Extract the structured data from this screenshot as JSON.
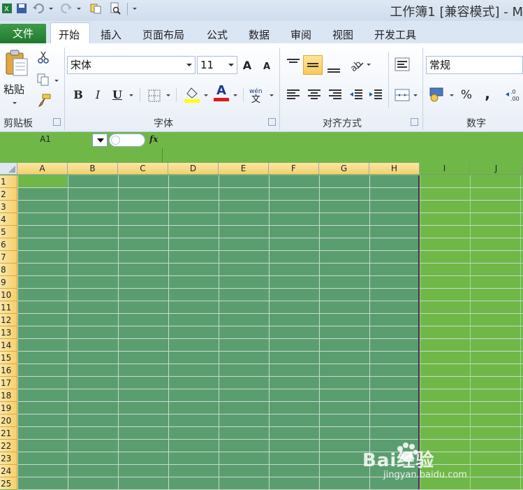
{
  "window": {
    "title": "工作簿1  [兼容模式]  -  M"
  },
  "tabs": {
    "file": "文件",
    "items": [
      "开始",
      "插入",
      "页面布局",
      "公式",
      "数据",
      "审阅",
      "视图",
      "开发工具"
    ]
  },
  "clipboard": {
    "paste_label": "粘贴",
    "group_label": "剪贴板"
  },
  "font": {
    "name": "宋体",
    "size": "11",
    "group_label": "字体",
    "bold": "B",
    "italic": "I",
    "underline": "U",
    "grow": "A",
    "shrink": "A",
    "font_color": "A"
  },
  "alignment": {
    "group_label": "对齐方式"
  },
  "number": {
    "format": "常规",
    "group_label": "数字",
    "percent": "%",
    "comma": ","
  },
  "formula_bar": {
    "name_box": "A1",
    "fx": "fx",
    "value": ""
  },
  "columns": [
    "A",
    "B",
    "C",
    "D",
    "E",
    "F",
    "G",
    "H",
    "I",
    "J"
  ],
  "rows": [
    "1",
    "2",
    "3",
    "4",
    "5",
    "6",
    "7",
    "8",
    "9",
    "10",
    "11",
    "12",
    "13",
    "14",
    "15",
    "16",
    "17",
    "18",
    "19",
    "20",
    "21",
    "22",
    "23",
    "24",
    "25"
  ],
  "watermark": {
    "brand": "Bai经验",
    "url": "jingyan.baidu.com"
  },
  "colors": {
    "sheet_bg": "#6fb848",
    "selection": "#5a9e70",
    "header_selected": "#f5cf6b",
    "file_tab": "#2e8a3c"
  }
}
